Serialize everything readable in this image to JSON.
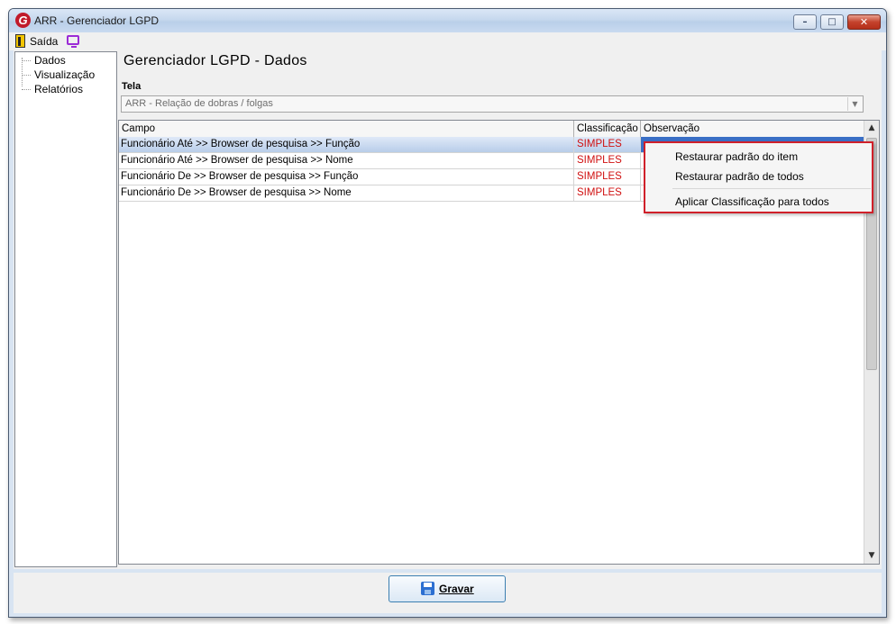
{
  "window": {
    "title": "ARR - Gerenciador LGPD",
    "controls": {
      "minimize": "–",
      "maximize": "□",
      "close": "✕"
    }
  },
  "menubar": {
    "exit_label": "Saída"
  },
  "sidebar": {
    "items": [
      {
        "label": "Dados"
      },
      {
        "label": "Visualização"
      },
      {
        "label": "Relatórios"
      }
    ]
  },
  "main": {
    "heading": "Gerenciador LGPD - Dados",
    "tela_label": "Tela",
    "tela_value": "ARR - Relação de dobras / folgas"
  },
  "grid": {
    "columns": [
      "Campo",
      "Classificação",
      "Observação"
    ],
    "rows": [
      {
        "campo": "Funcionário Até >> Browser de pesquisa >> Função",
        "classificacao": "SIMPLES",
        "observacao": ""
      },
      {
        "campo": "Funcionário Até >> Browser de pesquisa >> Nome",
        "classificacao": "SIMPLES",
        "observacao": ""
      },
      {
        "campo": "Funcionário De >> Browser de pesquisa >> Função",
        "classificacao": "SIMPLES",
        "observacao": ""
      },
      {
        "campo": "Funcionário De >> Browser de pesquisa >> Nome",
        "classificacao": "SIMPLES",
        "observacao": ""
      }
    ],
    "selected_row": 0
  },
  "context_menu": {
    "items": [
      {
        "label": "Restaurar padrão do item"
      },
      {
        "label": "Restaurar padrão de todos"
      },
      {
        "label": "Aplicar Classificação para todos"
      }
    ]
  },
  "footer": {
    "save_label": "Gravar"
  },
  "colors": {
    "classification_text": "#d01010",
    "context_menu_border": "#d0202a",
    "selection": "#3a6fc6",
    "close_button": "#c4422c"
  },
  "icons": {
    "app": "app-logo-icon",
    "exit": "exit-door-icon",
    "monitor": "monitor-icon",
    "save": "floppy-disk-icon",
    "dropdown": "chevron-down-icon"
  }
}
